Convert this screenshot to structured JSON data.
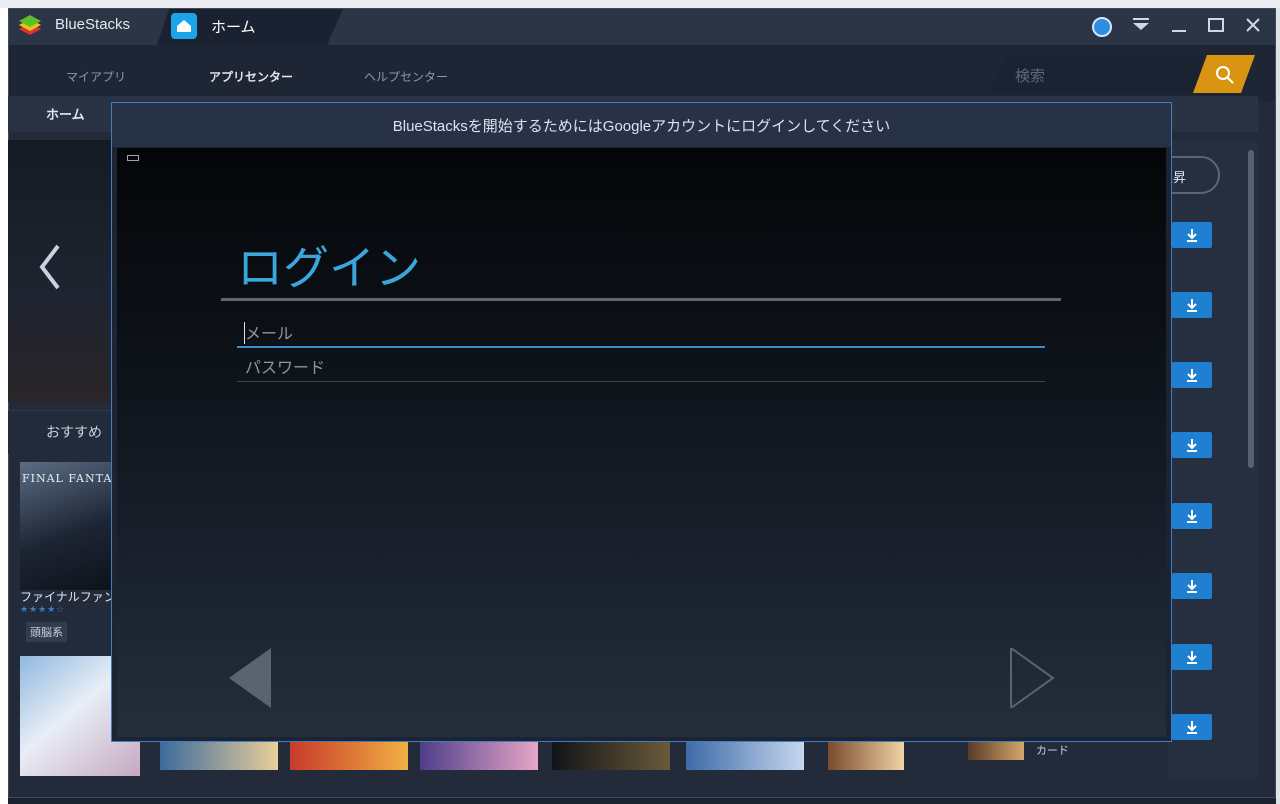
{
  "window": {
    "app_name": "BlueStacks",
    "tab_label": "ホーム"
  },
  "nav": {
    "items": [
      {
        "label": "マイアプリ",
        "active": false
      },
      {
        "label": "アプリセンター",
        "active": true
      },
      {
        "label": "ヘルプセンター",
        "active": false
      }
    ],
    "search_placeholder": "検索"
  },
  "subnav": {
    "home": "ホーム"
  },
  "background": {
    "recommended_label": "おすすめ",
    "game1_title": "ファイナルファン",
    "game1_art_text": "FINAL FANTAS",
    "game1_tag": "頭脳系",
    "rise_label": "上昇",
    "card_label": "カード"
  },
  "modal": {
    "title": "BlueStacksを開始するためにはGoogleアカウントにログインしてください",
    "login_heading": "ログイン",
    "email_placeholder": "メール",
    "password_placeholder": "パスワード"
  },
  "colors": {
    "accent": "#3aa7dc",
    "download": "#1f7fd0",
    "search_button": "#d99511"
  }
}
